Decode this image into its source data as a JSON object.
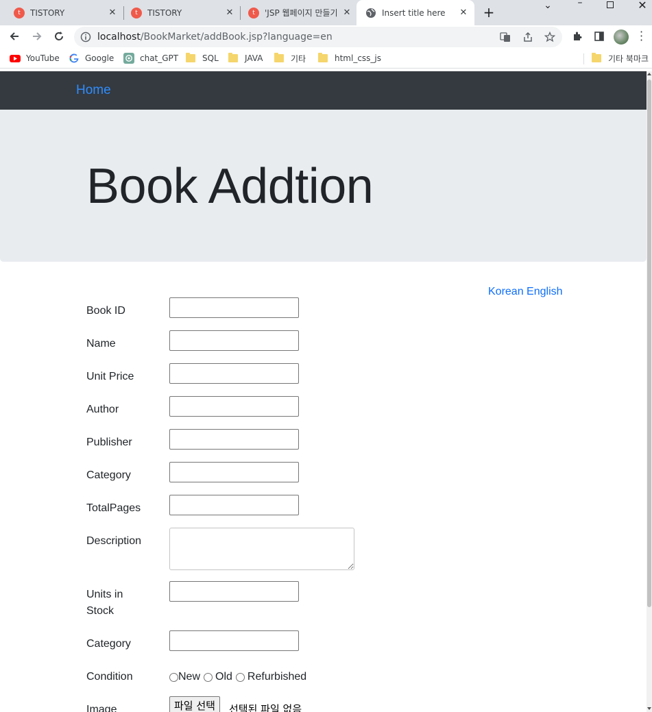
{
  "browser": {
    "tabs": [
      {
        "title": "TISTORY",
        "icon": "tistory-icon",
        "active": false
      },
      {
        "title": "TISTORY",
        "icon": "tistory-icon",
        "active": false
      },
      {
        "title": "'JSP 웹페이지 만들기",
        "icon": "tistory-icon",
        "active": false
      },
      {
        "title": "Insert title here",
        "icon": "globe-icon",
        "active": true
      }
    ],
    "url_host": "localhost",
    "url_path": "/BookMarket/addBook.jsp?language=en",
    "bookmarks": [
      {
        "label": "YouTube",
        "icon": "youtube-icon"
      },
      {
        "label": "Google",
        "icon": "google-icon"
      },
      {
        "label": "chat_GPT",
        "icon": "openai-icon"
      },
      {
        "label": "SQL",
        "icon": "folder-icon"
      },
      {
        "label": "JAVA",
        "icon": "folder-icon"
      },
      {
        "label": "기타",
        "icon": "folder-icon"
      },
      {
        "label": "html_css_js",
        "icon": "folder-icon"
      },
      {
        "label": "기타 북마크",
        "icon": "folder-icon"
      }
    ]
  },
  "page": {
    "nav": {
      "home_label": "Home"
    },
    "jumbotron": {
      "title": "Book Addtion"
    },
    "language": {
      "korean": "Korean",
      "english": "English"
    },
    "form": {
      "fields": [
        {
          "label": "Book ID"
        },
        {
          "label": "Name"
        },
        {
          "label": "Unit Price"
        },
        {
          "label": "Author"
        },
        {
          "label": "Publisher"
        },
        {
          "label": "Category"
        },
        {
          "label": "TotalPages"
        },
        {
          "label": "Description"
        },
        {
          "label": "Units in Stock"
        },
        {
          "label": "Category"
        }
      ],
      "condition_label": "Condition",
      "condition_options": [
        "New",
        "Old",
        "Refurbished"
      ],
      "image_label": "Image",
      "file_button": "파일 선택",
      "file_status": "선택된 파일 없음"
    }
  },
  "colors": {
    "navbar_bg": "#343a40",
    "jumbotron_bg": "#e9ecef",
    "link": "#0d6efd"
  }
}
